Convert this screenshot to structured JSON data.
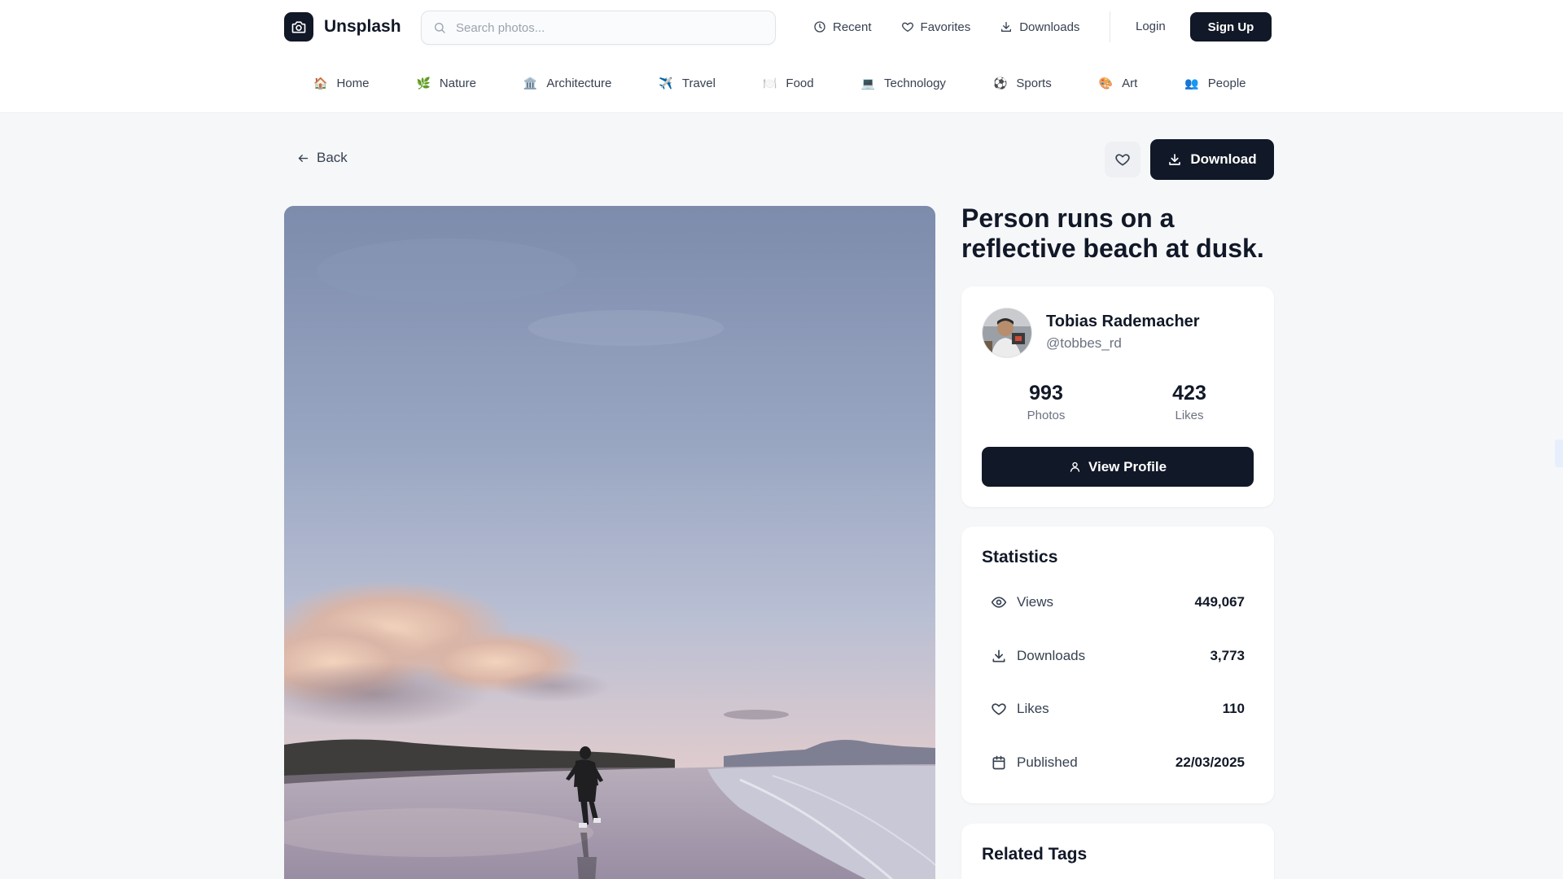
{
  "header": {
    "brand": "Unsplash",
    "search_placeholder": "Search photos...",
    "links": [
      {
        "label": "Recent",
        "icon": "clock-icon"
      },
      {
        "label": "Favorites",
        "icon": "heart-icon"
      },
      {
        "label": "Downloads",
        "icon": "download-icon"
      }
    ],
    "login": "Login",
    "signup": "Sign Up"
  },
  "categories": [
    {
      "emoji": "🏠",
      "label": "Home"
    },
    {
      "emoji": "🌿",
      "label": "Nature"
    },
    {
      "emoji": "🏛️",
      "label": "Architecture"
    },
    {
      "emoji": "✈️",
      "label": "Travel"
    },
    {
      "emoji": "🍽️",
      "label": "Food"
    },
    {
      "emoji": "💻",
      "label": "Technology"
    },
    {
      "emoji": "⚽",
      "label": "Sports"
    },
    {
      "emoji": "🎨",
      "label": "Art"
    },
    {
      "emoji": "👥",
      "label": "People"
    }
  ],
  "actions": {
    "back": "Back",
    "download": "Download"
  },
  "photo": {
    "title": "Person runs on a reflective beach at dusk."
  },
  "author": {
    "name": "Tobias Rademacher",
    "handle": "@tobbes_rd",
    "photos_count": "993",
    "photos_label": "Photos",
    "likes_count": "423",
    "likes_label": "Likes",
    "view_profile": "View Profile"
  },
  "statistics": {
    "title": "Statistics",
    "rows": [
      {
        "icon": "eye-icon",
        "label": "Views",
        "value": "449,067"
      },
      {
        "icon": "download-icon",
        "label": "Downloads",
        "value": "3,773"
      },
      {
        "icon": "heart-icon",
        "label": "Likes",
        "value": "110"
      },
      {
        "icon": "calendar-icon",
        "label": "Published",
        "value": "22/03/2025"
      }
    ]
  },
  "related_tags": {
    "title": "Related Tags"
  },
  "colors": {
    "primary": "#111827",
    "background": "#f6f7f9",
    "card": "#ffffff",
    "muted_text": "#6b7280"
  }
}
